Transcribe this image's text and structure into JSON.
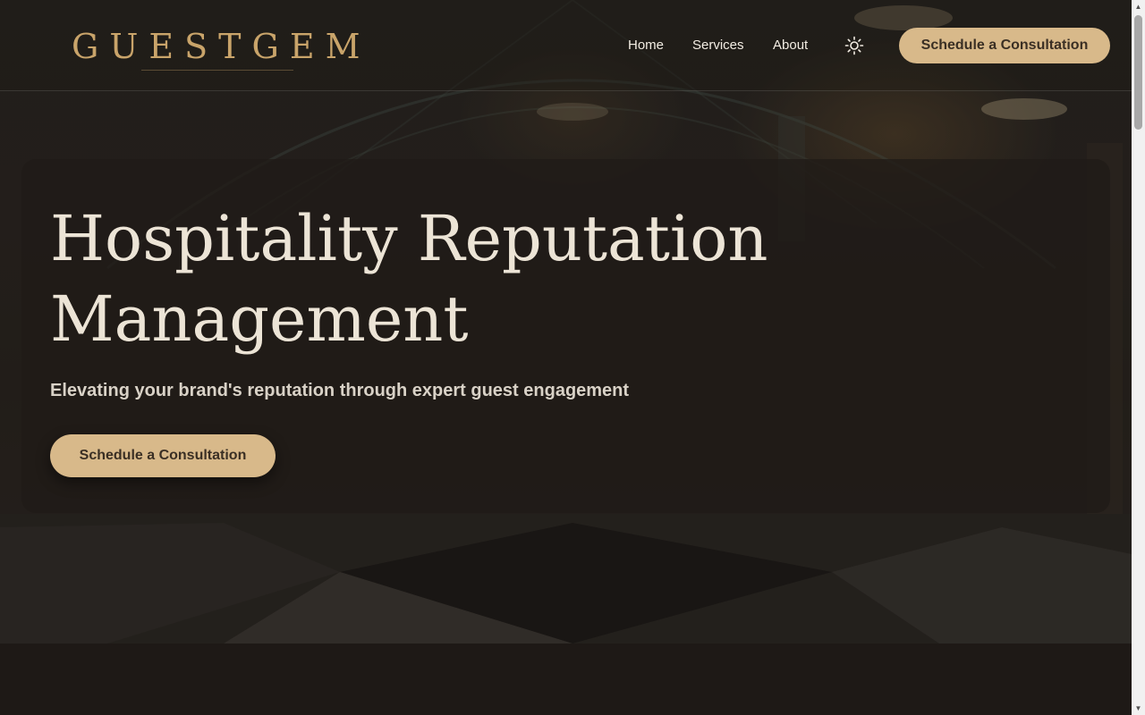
{
  "header": {
    "logo": "GUESTGEM",
    "nav": [
      {
        "label": "Home"
      },
      {
        "label": "Services"
      },
      {
        "label": "About"
      }
    ],
    "theme_toggle_icon": "sun-icon",
    "cta_label": "Schedule a Consultation"
  },
  "hero": {
    "title": "Hospitality Reputation Management",
    "subtitle": "Elevating your brand's reputation through expert guest engagement",
    "cta_label": "Schedule a Consultation"
  },
  "colors": {
    "accent": "#d8b98a",
    "logo": "#c9a46a",
    "background": "#1e1916"
  }
}
